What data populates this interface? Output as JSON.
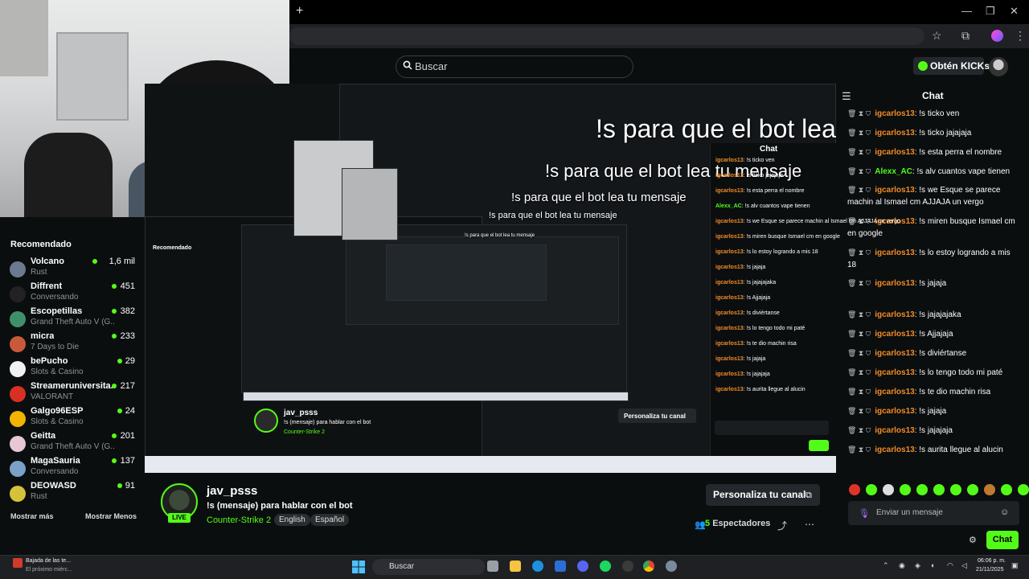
{
  "browser": {
    "new_tab": "+",
    "minimize": "—",
    "restore": "❐",
    "close": "✕"
  },
  "header": {
    "search_placeholder": "Buscar",
    "kicks_label": "Obtén KICKs"
  },
  "sidebar": {
    "title": "Recomendado",
    "items": [
      {
        "name": "Volcano",
        "game": "Rust",
        "count": "1,6 mil",
        "color": "#6b7a8f"
      },
      {
        "name": "Diffrent",
        "game": "Conversando",
        "count": "451",
        "color": "#222"
      },
      {
        "name": "Escopetillas",
        "game": "Grand Theft Auto V (G...",
        "count": "382",
        "color": "#3f8f6b"
      },
      {
        "name": "micra",
        "game": "7 Days to Die",
        "count": "233",
        "color": "#c85a3a"
      },
      {
        "name": "bePucho",
        "game": "Slots & Casino",
        "count": "29",
        "color": "#f1f1f1"
      },
      {
        "name": "Streameruniversita...",
        "game": "VALORANT",
        "count": "217",
        "color": "#d93025"
      },
      {
        "name": "Galgo96ESP",
        "game": "Slots & Casino",
        "count": "24",
        "color": "#f2b400"
      },
      {
        "name": "Geitta",
        "game": "Grand Theft Auto V (G...",
        "count": "201",
        "color": "#e8c6d6"
      },
      {
        "name": "MagaSauria",
        "game": "Conversando",
        "count": "137",
        "color": "#7aa2c8"
      },
      {
        "name": "DEOWASD",
        "game": "Rust",
        "count": "91",
        "color": "#d6c23a"
      }
    ],
    "show_more": "Mostrar más",
    "show_less": "Mostrar Menos"
  },
  "overlay": {
    "text": "!s para que el bot lea tu mensaje"
  },
  "channel": {
    "name": "jav_psss",
    "live": "LIVE",
    "title": "!s (mensaje) para hablar con el bot",
    "category": "Counter-Strike 2",
    "tags": [
      "English",
      "Español"
    ],
    "customize": "Personaliza tu canal",
    "viewers_count": "5",
    "viewers_label": "Espectadores"
  },
  "chat": {
    "title": "Chat",
    "messages": [
      {
        "user": "igcarlos13",
        "text": ": !s ticko ven",
        "color": "#f28c28"
      },
      {
        "user": "igcarlos13",
        "text": ": !s ticko jajajaja",
        "color": "#f28c28"
      },
      {
        "user": "igcarlos13",
        "text": ": !s esta perra el nombre",
        "color": "#f28c28"
      },
      {
        "user": "Alexx_AC",
        "text": ": !s alv cuantos vape tienen",
        "color": "#53fc18"
      },
      {
        "user": "igcarlos13",
        "text": ": !s we Esque se parece machin al Ismael cm AJJAJA un vergo",
        "color": "#f28c28"
      },
      {
        "user": "igcarlos13",
        "text": ": !s miren busque Ismael cm en google",
        "color": "#f28c28"
      },
      {
        "user": "igcarlos13",
        "text": ": !s lo estoy logrando a mis 18",
        "color": "#f28c28"
      },
      {
        "user": "igcarlos13",
        "text": ": !s jajaja",
        "color": "#f28c28"
      },
      {
        "user": "igcarlos13",
        "text": ": !s jajajajaka",
        "color": "#f28c28"
      },
      {
        "user": "igcarlos13",
        "text": ": !s Ajjajaja",
        "color": "#f28c28"
      },
      {
        "user": "igcarlos13",
        "text": ": !s diviértanse",
        "color": "#f28c28"
      },
      {
        "user": "igcarlos13",
        "text": ": !s lo tengo todo mi paté",
        "color": "#f28c28"
      },
      {
        "user": "igcarlos13",
        "text": ": !s te dio machin risa",
        "color": "#f28c28"
      },
      {
        "user": "igcarlos13",
        "text": ": !s jajaja",
        "color": "#f28c28"
      },
      {
        "user": "igcarlos13",
        "text": ": !s jajajaja",
        "color": "#f28c28"
      },
      {
        "user": "igcarlos13",
        "text": ": !s aurita llegue al alucin",
        "color": "#f28c28"
      }
    ],
    "input_placeholder": "Enviar un mensaje",
    "send_label": "Chat"
  },
  "taskbar": {
    "notif_title": "Bajada de las te...",
    "notif_sub": "El próximo miérc...",
    "search": "Buscar",
    "time": "06:06 p. m.",
    "date": "21/11/2025"
  },
  "colors": {
    "accent": "#53fc18",
    "background": "#0b0e0f",
    "username_orange": "#f28c28"
  }
}
